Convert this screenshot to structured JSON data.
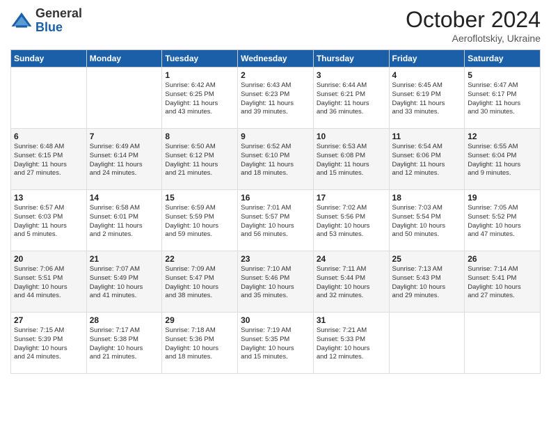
{
  "header": {
    "logo_general": "General",
    "logo_blue": "Blue",
    "month_title": "October 2024",
    "location": "Aeroflotskiy, Ukraine"
  },
  "weekdays": [
    "Sunday",
    "Monday",
    "Tuesday",
    "Wednesday",
    "Thursday",
    "Friday",
    "Saturday"
  ],
  "weeks": [
    [
      {
        "day": "",
        "info": ""
      },
      {
        "day": "",
        "info": ""
      },
      {
        "day": "1",
        "info": "Sunrise: 6:42 AM\nSunset: 6:25 PM\nDaylight: 11 hours\nand 43 minutes."
      },
      {
        "day": "2",
        "info": "Sunrise: 6:43 AM\nSunset: 6:23 PM\nDaylight: 11 hours\nand 39 minutes."
      },
      {
        "day": "3",
        "info": "Sunrise: 6:44 AM\nSunset: 6:21 PM\nDaylight: 11 hours\nand 36 minutes."
      },
      {
        "day": "4",
        "info": "Sunrise: 6:45 AM\nSunset: 6:19 PM\nDaylight: 11 hours\nand 33 minutes."
      },
      {
        "day": "5",
        "info": "Sunrise: 6:47 AM\nSunset: 6:17 PM\nDaylight: 11 hours\nand 30 minutes."
      }
    ],
    [
      {
        "day": "6",
        "info": "Sunrise: 6:48 AM\nSunset: 6:15 PM\nDaylight: 11 hours\nand 27 minutes."
      },
      {
        "day": "7",
        "info": "Sunrise: 6:49 AM\nSunset: 6:14 PM\nDaylight: 11 hours\nand 24 minutes."
      },
      {
        "day": "8",
        "info": "Sunrise: 6:50 AM\nSunset: 6:12 PM\nDaylight: 11 hours\nand 21 minutes."
      },
      {
        "day": "9",
        "info": "Sunrise: 6:52 AM\nSunset: 6:10 PM\nDaylight: 11 hours\nand 18 minutes."
      },
      {
        "day": "10",
        "info": "Sunrise: 6:53 AM\nSunset: 6:08 PM\nDaylight: 11 hours\nand 15 minutes."
      },
      {
        "day": "11",
        "info": "Sunrise: 6:54 AM\nSunset: 6:06 PM\nDaylight: 11 hours\nand 12 minutes."
      },
      {
        "day": "12",
        "info": "Sunrise: 6:55 AM\nSunset: 6:04 PM\nDaylight: 11 hours\nand 9 minutes."
      }
    ],
    [
      {
        "day": "13",
        "info": "Sunrise: 6:57 AM\nSunset: 6:03 PM\nDaylight: 11 hours\nand 5 minutes."
      },
      {
        "day": "14",
        "info": "Sunrise: 6:58 AM\nSunset: 6:01 PM\nDaylight: 11 hours\nand 2 minutes."
      },
      {
        "day": "15",
        "info": "Sunrise: 6:59 AM\nSunset: 5:59 PM\nDaylight: 10 hours\nand 59 minutes."
      },
      {
        "day": "16",
        "info": "Sunrise: 7:01 AM\nSunset: 5:57 PM\nDaylight: 10 hours\nand 56 minutes."
      },
      {
        "day": "17",
        "info": "Sunrise: 7:02 AM\nSunset: 5:56 PM\nDaylight: 10 hours\nand 53 minutes."
      },
      {
        "day": "18",
        "info": "Sunrise: 7:03 AM\nSunset: 5:54 PM\nDaylight: 10 hours\nand 50 minutes."
      },
      {
        "day": "19",
        "info": "Sunrise: 7:05 AM\nSunset: 5:52 PM\nDaylight: 10 hours\nand 47 minutes."
      }
    ],
    [
      {
        "day": "20",
        "info": "Sunrise: 7:06 AM\nSunset: 5:51 PM\nDaylight: 10 hours\nand 44 minutes."
      },
      {
        "day": "21",
        "info": "Sunrise: 7:07 AM\nSunset: 5:49 PM\nDaylight: 10 hours\nand 41 minutes."
      },
      {
        "day": "22",
        "info": "Sunrise: 7:09 AM\nSunset: 5:47 PM\nDaylight: 10 hours\nand 38 minutes."
      },
      {
        "day": "23",
        "info": "Sunrise: 7:10 AM\nSunset: 5:46 PM\nDaylight: 10 hours\nand 35 minutes."
      },
      {
        "day": "24",
        "info": "Sunrise: 7:11 AM\nSunset: 5:44 PM\nDaylight: 10 hours\nand 32 minutes."
      },
      {
        "day": "25",
        "info": "Sunrise: 7:13 AM\nSunset: 5:43 PM\nDaylight: 10 hours\nand 29 minutes."
      },
      {
        "day": "26",
        "info": "Sunrise: 7:14 AM\nSunset: 5:41 PM\nDaylight: 10 hours\nand 27 minutes."
      }
    ],
    [
      {
        "day": "27",
        "info": "Sunrise: 7:15 AM\nSunset: 5:39 PM\nDaylight: 10 hours\nand 24 minutes."
      },
      {
        "day": "28",
        "info": "Sunrise: 7:17 AM\nSunset: 5:38 PM\nDaylight: 10 hours\nand 21 minutes."
      },
      {
        "day": "29",
        "info": "Sunrise: 7:18 AM\nSunset: 5:36 PM\nDaylight: 10 hours\nand 18 minutes."
      },
      {
        "day": "30",
        "info": "Sunrise: 7:19 AM\nSunset: 5:35 PM\nDaylight: 10 hours\nand 15 minutes."
      },
      {
        "day": "31",
        "info": "Sunrise: 7:21 AM\nSunset: 5:33 PM\nDaylight: 10 hours\nand 12 minutes."
      },
      {
        "day": "",
        "info": ""
      },
      {
        "day": "",
        "info": ""
      }
    ]
  ]
}
